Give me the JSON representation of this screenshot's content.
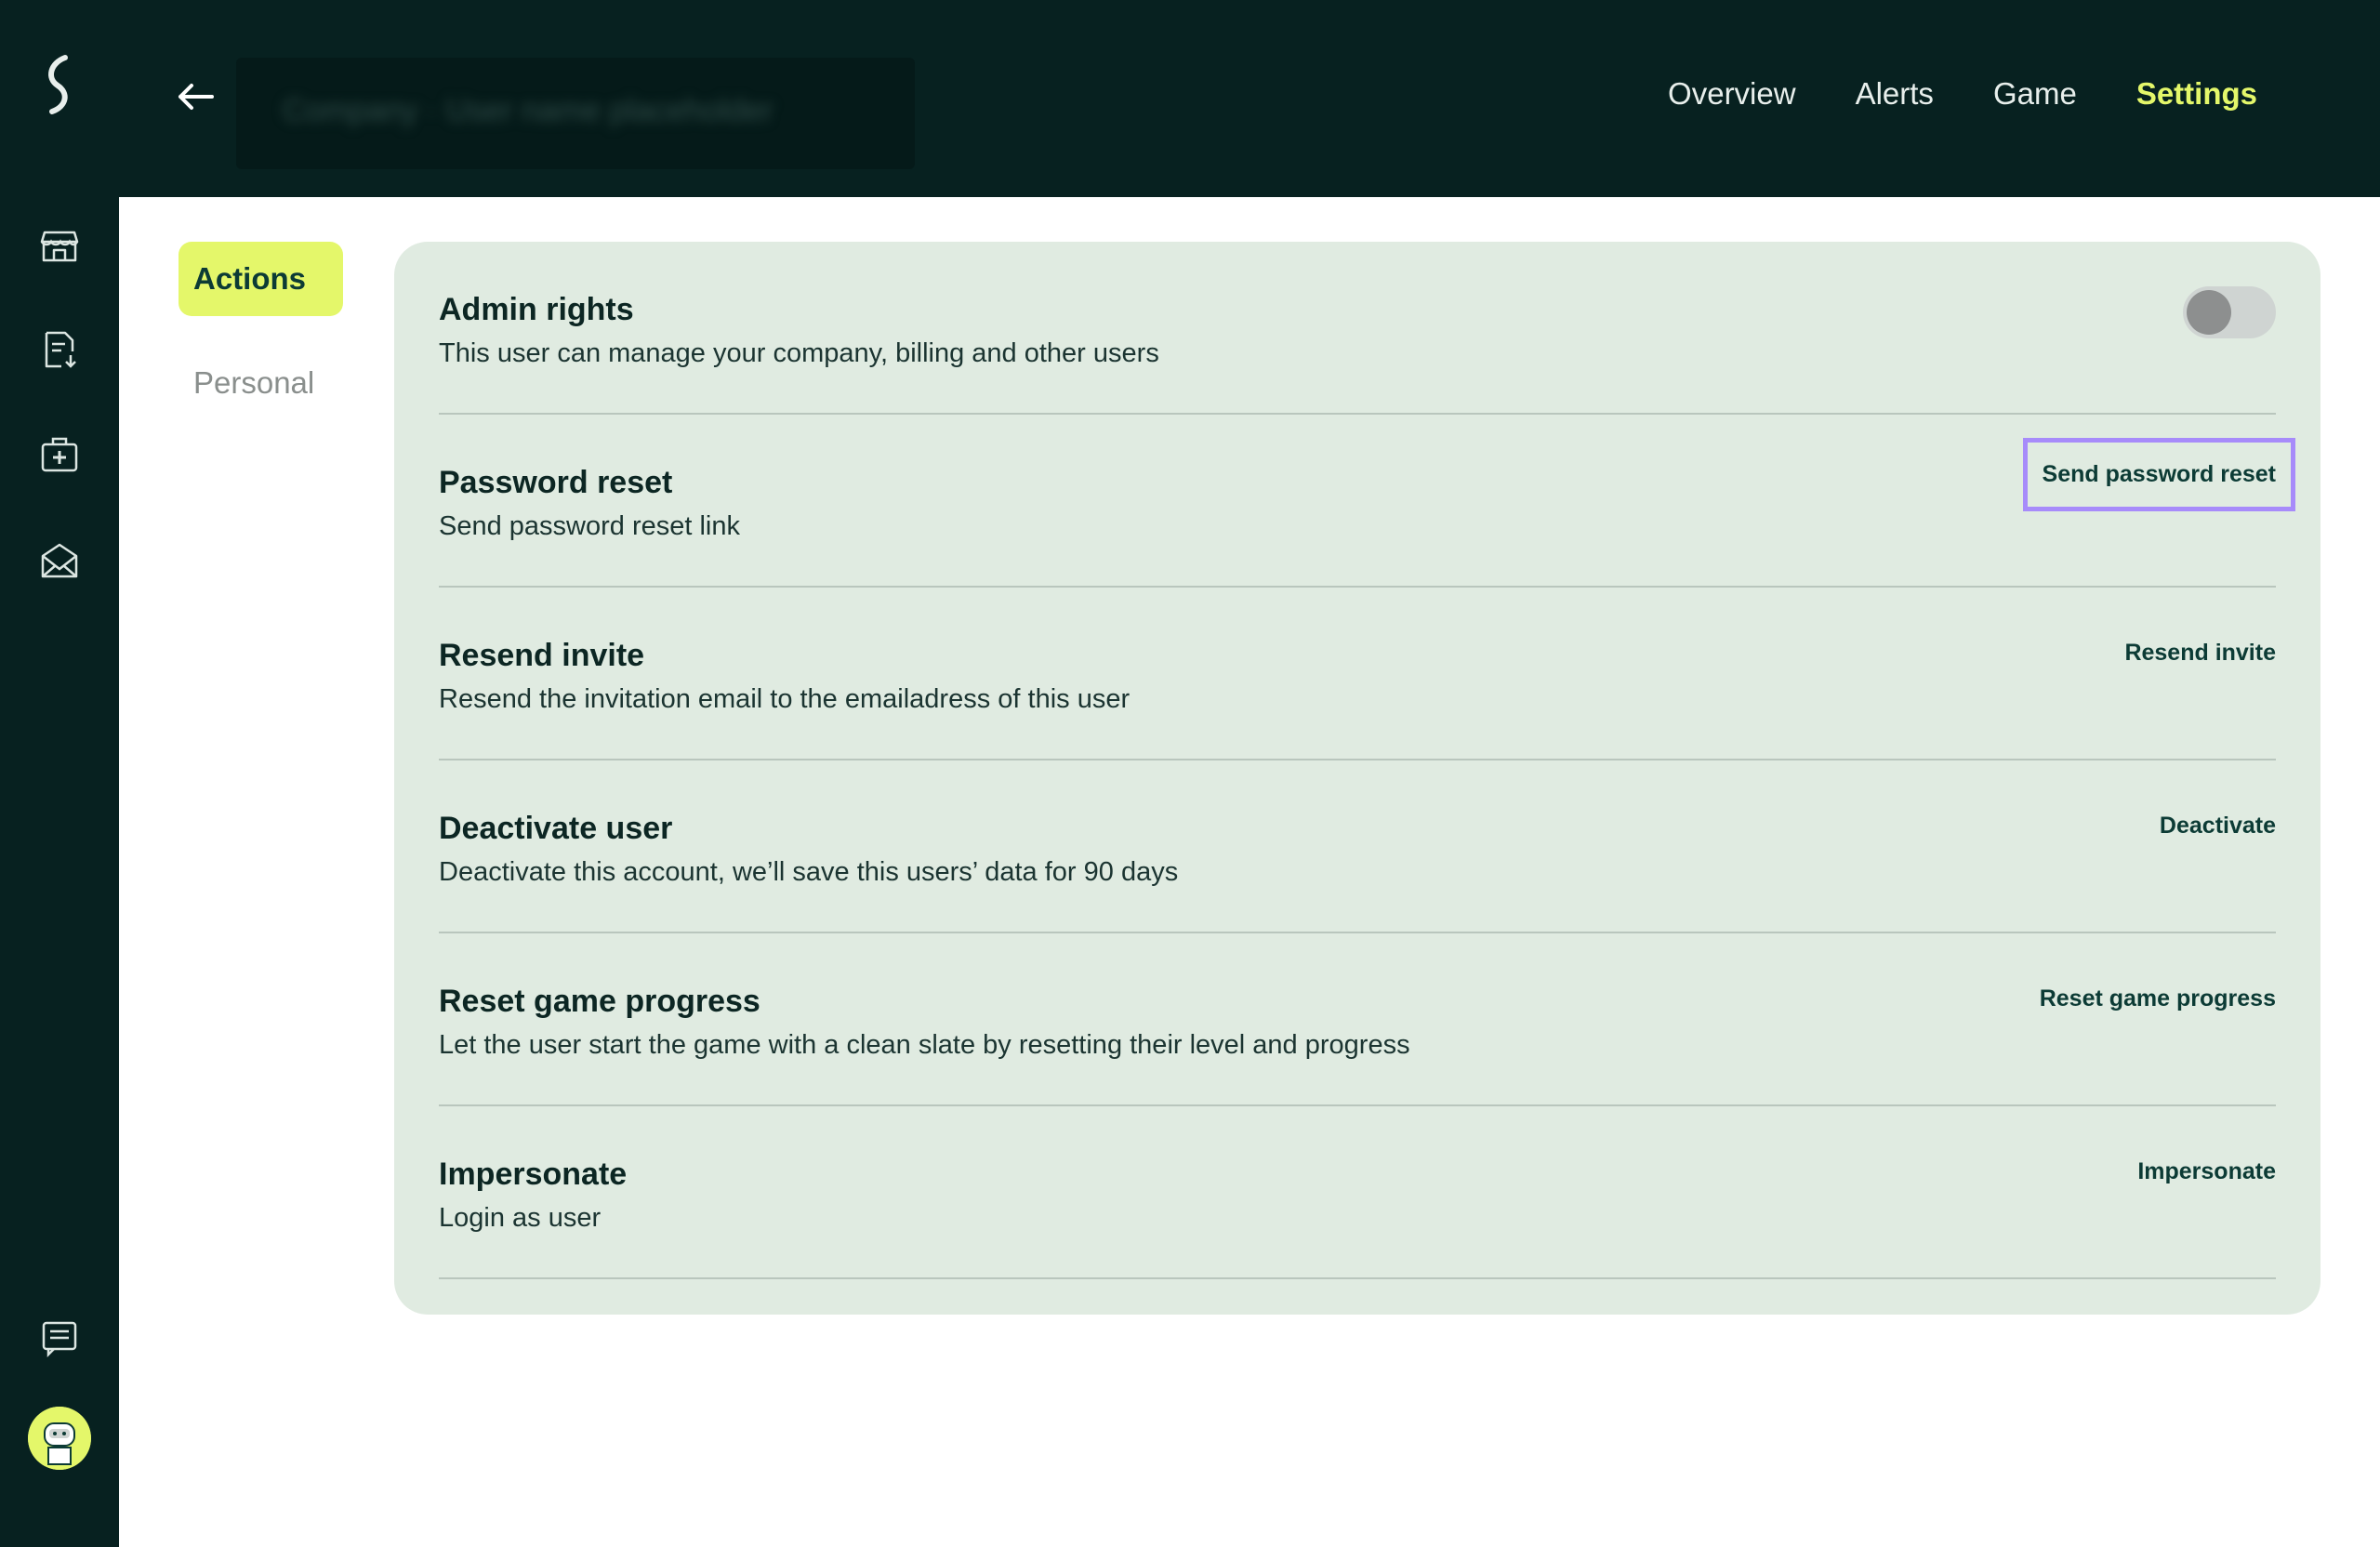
{
  "header": {
    "back_icon": "arrow-left-icon",
    "breadcrumb_blurred": "Company · User name placeholder",
    "tabs": [
      {
        "label": "Overview",
        "active": false
      },
      {
        "label": "Alerts",
        "active": false
      },
      {
        "label": "Game",
        "active": false
      },
      {
        "label": "Settings",
        "active": true
      }
    ]
  },
  "sidebar": {
    "icons": [
      "logo-icon",
      "store-icon",
      "document-download-icon",
      "medical-kit-icon",
      "mail-icon",
      "chat-icon"
    ],
    "avatar": "robot-avatar"
  },
  "side_tabs": [
    {
      "label": "Actions",
      "active": true
    },
    {
      "label": "Personal",
      "active": false
    }
  ],
  "actions": {
    "admin": {
      "title": "Admin rights",
      "description": "This user can manage your company, billing and other users",
      "toggle_on": false
    },
    "password_reset": {
      "title": "Password reset",
      "description": "Send password reset link",
      "button": "Send password reset"
    },
    "resend_invite": {
      "title": "Resend invite",
      "description": "Resend the invitation email to the emailadress of this user",
      "button": "Resend invite"
    },
    "deactivate": {
      "title": "Deactivate user",
      "description": "Deactivate this account, we’ll save this users’ data for 90 days",
      "button": "Deactivate"
    },
    "reset_game": {
      "title": "Reset game progress",
      "description": "Let the user start the game with a clean slate by resetting their level and progress",
      "button": "Reset game progress"
    },
    "impersonate": {
      "title": "Impersonate",
      "description": "Login as user",
      "button": "Impersonate"
    }
  },
  "colors": {
    "dark": "#072120",
    "accent": "#e4f76a",
    "card": "#e0ebe1",
    "focus": "#a78bfa"
  }
}
